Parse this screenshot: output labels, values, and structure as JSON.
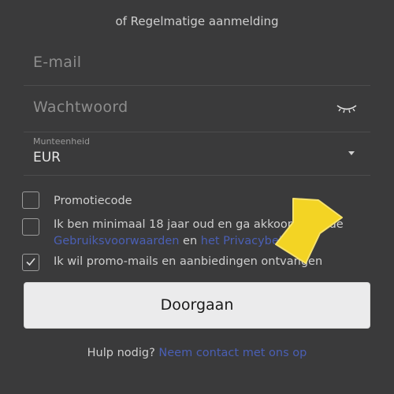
{
  "header": {
    "subtitle": "of Regelmatige aanmelding"
  },
  "form": {
    "email_placeholder": "E-mail",
    "password_placeholder": "Wachtwoord",
    "password_toggle_icon": "eye-closed-icon",
    "currency_label": "Munteenheid",
    "currency_value": "EUR",
    "currency_dropdown_icon": "caret-down-icon"
  },
  "checkboxes": {
    "promo_code": {
      "label": "Promotiecode",
      "checked": false
    },
    "terms": {
      "text_1": "Ik ben minimaal 18 jaar oud en ga akkoord met de",
      "link_terms": "Gebruiksvoorwaarden",
      "text_2": " en ",
      "link_privacy": "het Privacybeleid",
      "checked": false
    },
    "promo_mails": {
      "label": "Ik wil promo-mails en aanbiedingen ontvangen",
      "checked": true
    }
  },
  "actions": {
    "continue_label": "Doorgaan"
  },
  "help": {
    "text": "Hulp nodig? ",
    "link": "Neem contact met ons op"
  },
  "annotation": {
    "arrow_icon": "yellow-arrow-pointer-icon",
    "arrow_color": "#f3d424"
  },
  "colors": {
    "background": "#3a3a3b",
    "link": "#4a5fb5",
    "button_bg": "#ebebec"
  }
}
